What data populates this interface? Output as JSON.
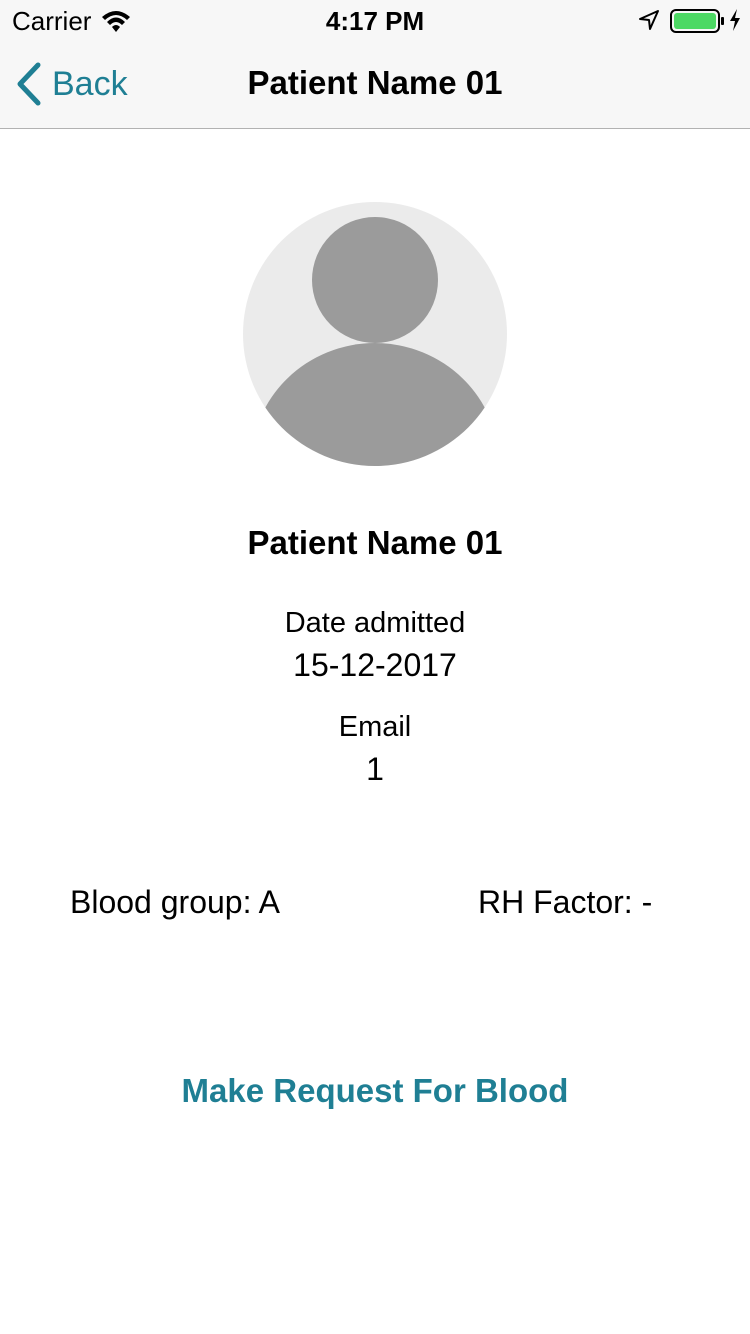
{
  "status_bar": {
    "carrier": "Carrier",
    "time": "4:17 PM",
    "battery_color": "#4cd964"
  },
  "nav": {
    "back_label": "Back",
    "title": "Patient Name 01",
    "accent_color": "#1f7f94"
  },
  "patient": {
    "name": "Patient Name 01",
    "date_admitted_label": "Date admitted",
    "date_admitted_value": "15-12-2017",
    "email_label": "Email",
    "email_value": "1",
    "blood_group": "Blood group: A",
    "rh_factor": "RH Factor: -"
  },
  "actions": {
    "request_blood_label": "Make Request For Blood"
  },
  "icons": [
    "wifi-icon",
    "location-icon",
    "battery-icon",
    "charge-icon",
    "back-chevron-icon",
    "avatar-placeholder-icon"
  ]
}
